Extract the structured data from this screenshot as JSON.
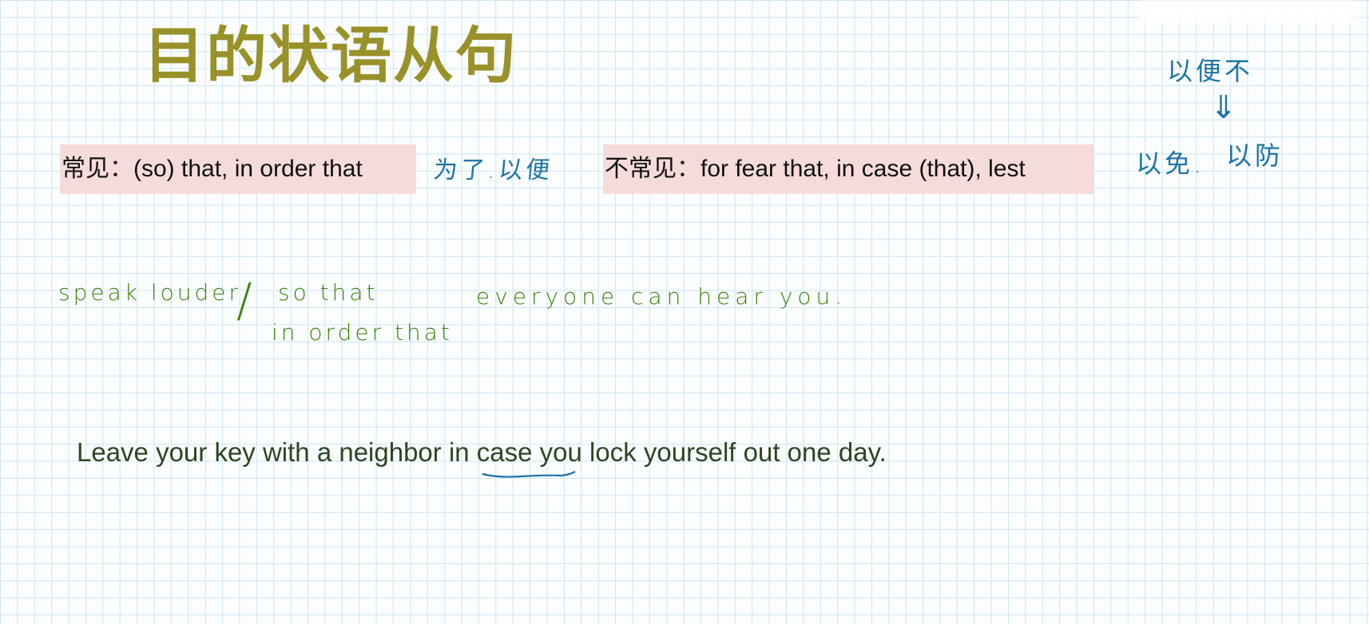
{
  "title": "目的状语从句",
  "common": {
    "label": "常见：(so) that, in order that",
    "note": "为了.以便"
  },
  "uncommon": {
    "label": "不常见：for fear that, in case (that), lest"
  },
  "right_notes": {
    "top": "以便不",
    "arrow": "⇓",
    "left": "以免.",
    "right": "以防"
  },
  "example1": {
    "part1": "speak louder",
    "slash": "/",
    "alt1": "so that",
    "alt2": "in order that",
    "part2": "everyone can hear you."
  },
  "example2": {
    "before": "Leave your key with a neighbor ",
    "highlight": "in case",
    "after": " you lock yourself out one day."
  },
  "colors": {
    "title": "#999129",
    "highlight_bg": "#f5dcda",
    "ink_blue": "#1c74a6",
    "ink_green": "#3d8410",
    "body_text": "#2e4422"
  }
}
